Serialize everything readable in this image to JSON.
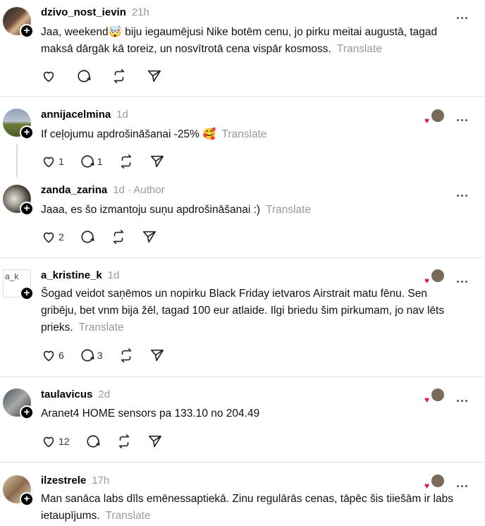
{
  "posts": [
    {
      "username": "dzivo_nost_ievin",
      "time": "21h",
      "text": "Jaa, weekend🤯 biju iegaumējusi Nike botēm cenu, jo pirku meitai augustā, tagad maksā dārgāk kā toreiz, un nosvītrotā cena vispār kosmoss.",
      "translate": "Translate",
      "likes": "",
      "replies": ""
    },
    {
      "username": "annijacelmina",
      "time": "1d",
      "text": "If ceļojumu apdrošināšanai -25% 🥰",
      "translate": "Translate",
      "likes": "1",
      "replies": "1"
    },
    {
      "username": "zanda_zarina",
      "time": "1d",
      "author": "· Author",
      "text": "Jaaa, es šo izmantoju suņu apdrošināšanai :)",
      "translate": "Translate",
      "likes": "2",
      "replies": ""
    },
    {
      "username": "a_kristine_k",
      "time": "1d",
      "avatar_alt": "a_k",
      "text": "Šogad veidot saņēmos un nopirku Black Friday ietvaros Airstrait matu fēnu. Sen gribēju, bet vnm bija žēl, tagad 100 eur atlaide. Ilgi briedu šim pirkumam, jo nav lēts prieks.",
      "translate": "Translate",
      "likes": "6",
      "replies": "3"
    },
    {
      "username": "taulavicus",
      "time": "2d",
      "text": "Aranet4 HOME sensors pa 133.10 no 204.49",
      "translate": "",
      "likes": "12",
      "replies": ""
    },
    {
      "username": "ilzestrele",
      "time": "17h",
      "text": "Man sanāca labs dīls emēnessaptiekā. Zinu regulārās cenas, tāpēc šis tiiešām ir labs ietaupījums.",
      "translate": "Translate",
      "likes": "",
      "replies": ""
    }
  ],
  "icons": {
    "like": "heart-icon",
    "reply": "comment-icon",
    "repost": "repost-icon",
    "share": "send-icon",
    "more": "more-icon",
    "follow": "plus-icon"
  },
  "colors": {
    "liked_heart": "#e5183a",
    "muted": "#999999"
  }
}
